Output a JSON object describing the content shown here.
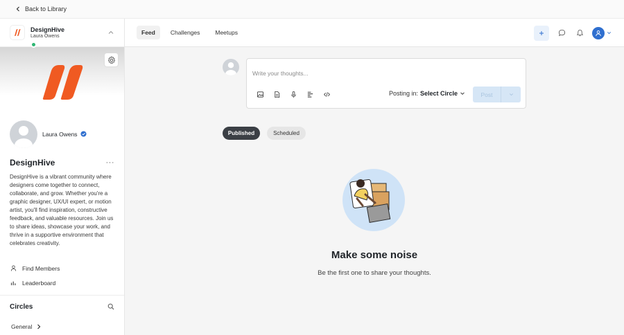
{
  "topbar": {
    "back_label": "Back to Library"
  },
  "brand": {
    "name": "DesignHive",
    "user": "Laura Owens",
    "accent": "#f05a22"
  },
  "profile": {
    "name": "Laura Owens",
    "verified_color": "#2f6fcf",
    "status_color": "#2fb774"
  },
  "community": {
    "title": "DesignHive",
    "menu_glyph": "···",
    "description": "DesignHive is a vibrant community where designers come together to connect, collaborate, and grow. Whether you're a graphic designer, UX/UI expert, or motion artist, you'll find inspiration, constructive feedback, and valuable resources. Join us to share ideas, showcase your work, and thrive in a supportive environment that celebrates creativity."
  },
  "sidebar": {
    "nav": [
      {
        "label": "Find Members",
        "icon": "person-icon"
      },
      {
        "label": "Leaderboard",
        "icon": "bar-chart-icon"
      }
    ],
    "circles_title": "Circles",
    "circles": [
      {
        "label": "General"
      }
    ]
  },
  "header": {
    "tabs": [
      {
        "label": "Feed",
        "active": true
      },
      {
        "label": "Challenges",
        "active": false
      },
      {
        "label": "Meetups",
        "active": false
      }
    ],
    "icons": [
      "plus-icon",
      "chat-icon",
      "bell-icon",
      "user-avatar-icon"
    ]
  },
  "composer": {
    "placeholder": "Write your thoughts...",
    "posting_prefix": "Posting in:",
    "posting_target": "Select Circle",
    "post_label": "Post",
    "tools": [
      "image-icon",
      "document-icon",
      "microphone-icon",
      "poll-icon",
      "code-icon"
    ]
  },
  "filters": {
    "published": "Published",
    "scheduled": "Scheduled"
  },
  "empty": {
    "title": "Make some noise",
    "subtitle": "Be the first one to share your thoughts."
  }
}
